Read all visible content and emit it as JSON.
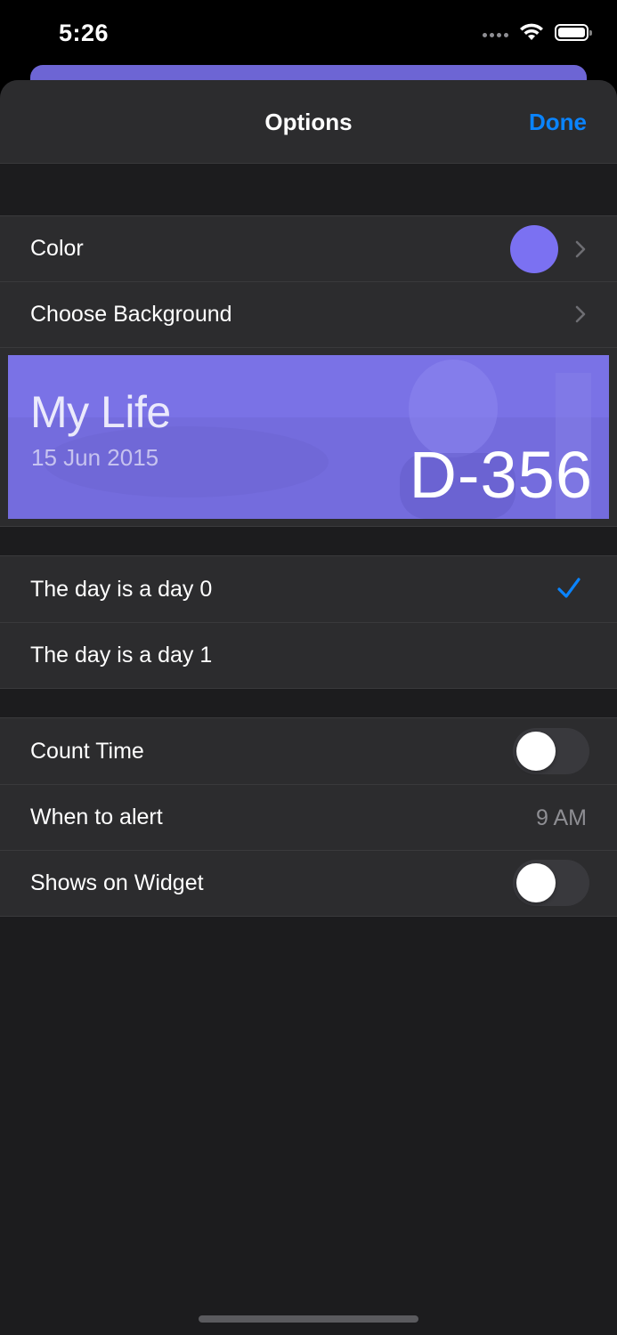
{
  "status_bar": {
    "time": "5:26"
  },
  "nav": {
    "title": "Options",
    "done_label": "Done"
  },
  "appearance": {
    "color_label": "Color",
    "color_value": "#7b71f2",
    "background_label": "Choose Background"
  },
  "preview": {
    "title": "My Life",
    "date": "15 Jun 2015",
    "count": "D-356"
  },
  "day_mode": {
    "options": [
      {
        "label": "The day is a day 0",
        "selected": true
      },
      {
        "label": "The day is a day 1",
        "selected": false
      }
    ]
  },
  "settings": {
    "count_time_label": "Count Time",
    "count_time_on": false,
    "alert_label": "When to alert",
    "alert_value": "9 AM",
    "widget_label": "Shows on Widget",
    "widget_on": false
  },
  "colors": {
    "accent": "#0a84ff",
    "sheet_bg": "#1c1c1e",
    "row_bg": "#2c2c2e"
  }
}
